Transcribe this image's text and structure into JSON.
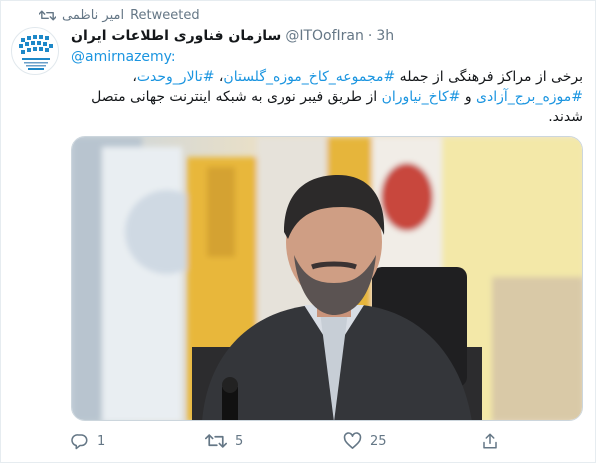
{
  "retweet": {
    "icon": "retweet-icon",
    "label": "Retweeted",
    "user": "امیر ناظمی"
  },
  "author": {
    "display_name": "سازمان فناوری اطلاعات ایران",
    "handle": "@ITOofIran",
    "separator": "·",
    "time": "3h",
    "avatar_icon": "organization-logo-icon"
  },
  "reply_to": "@amirnazemy:",
  "tweet": {
    "segments": [
      {
        "text": "برخی از مراکز فرهنگی از جمله ",
        "type": "text"
      },
      {
        "text": "#مجموعه_کاخ_موزه_گلستان",
        "type": "hashtag"
      },
      {
        "text": "، ",
        "type": "text"
      },
      {
        "text": "#تالار_وحدت",
        "type": "hashtag"
      },
      {
        "text": "، ",
        "type": "text"
      },
      {
        "text": "#موزه_برج_آزادی",
        "type": "hashtag"
      },
      {
        "text": " و ",
        "type": "text"
      },
      {
        "text": "#کاخ_نیاوران",
        "type": "hashtag"
      },
      {
        "text": " از طریق فیبر نوری به شبکه اینترنت جهانی متصل شدند.",
        "type": "text"
      }
    ]
  },
  "media": {
    "description_icon": "photo"
  },
  "actions": {
    "reply": {
      "icon": "reply-icon",
      "count": "1"
    },
    "retweet": {
      "icon": "retweet-icon",
      "count": "5"
    },
    "like": {
      "icon": "heart-icon",
      "count": "25"
    },
    "share": {
      "icon": "share-icon"
    }
  },
  "colors": {
    "accent": "#1b95e0",
    "muted": "#657786",
    "text": "#14171a"
  }
}
